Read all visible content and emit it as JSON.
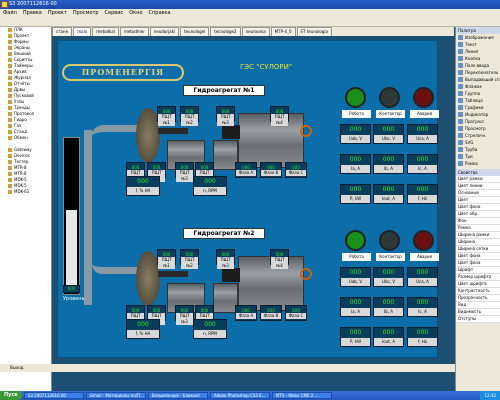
{
  "window": {
    "title": "S3 2007112616 00"
  },
  "menu": [
    "Файл",
    "Правка",
    "Проект",
    "Просмотр",
    "Сервис",
    "Окно",
    "Справка"
  ],
  "tabs": [
    "станн",
    "main",
    "metodkal",
    "metodmer",
    "neudorjakl",
    "teunologel",
    "tecnologe2",
    "neuroonia",
    "МТР-4_0",
    "ST teunologia"
  ],
  "left_tree": [
    "ПЛК",
    "Проект",
    "Формы",
    "Экраны",
    "Вешний",
    "Скрипты",
    "Таймеры",
    "Архив",
    "Журнал",
    "Отчёты",
    "Дрвы",
    "Пусковой",
    "Узлы",
    "Тренды",
    "Протокол",
    "Гидро",
    "Газ",
    "Станд",
    "Обмен"
  ],
  "left_tree2": [
    "Gateway",
    "Devices",
    "Тестер",
    "MTR-8",
    "MTR-8",
    "MDK-5",
    "MDK-5",
    "MDK-61"
  ],
  "right_panel": {
    "title": "Палитра",
    "items": [
      "Изображения",
      "Текст",
      "Линия",
      "Кнопка",
      "Поле ввода",
      "Переключатель",
      "Выпадающий список",
      "Флажок",
      "Группа",
      "Таблица",
      "Графики",
      "Индикатор",
      "Прогресс",
      "Просмотр",
      "Стрелочн.",
      "SVG",
      "Труба",
      "Три",
      "Рамка"
    ],
    "props_title": "Свойства",
    "props": [
      "Цвет рамки",
      "Цвет линии",
      "Основные",
      "Цвет",
      "Цвет фона",
      "Цвет обр.",
      "Фон",
      "Рамка",
      "Ширина рамки",
      "Ширина",
      "Ширина сетки",
      "Цвет фона",
      "Цвет фона",
      "Шрифт",
      "Размер шрифта",
      "Цвет шрифта",
      "Контрастность",
      "Прозрачность",
      "Вид",
      "Видимость",
      "Отступы"
    ]
  },
  "logo": "ПРОМЕНЕРГІЯ",
  "station": "ГЭС \"СУЛОРИ\"",
  "units": [
    {
      "title": "Гидроагрегат №1",
      "top_vals": [
        "000",
        "000",
        "000",
        "000"
      ],
      "top_labels": [
        "ПЩТ №1",
        "ПЩТ №2",
        "ПЩТ №3",
        "ПЩТ №4"
      ],
      "mid_vals": [
        "000",
        "000",
        "000",
        "000"
      ],
      "mid_labels": [
        "ПЩТ №1",
        "ПЩТ №2",
        "ПЩТ №3",
        "ПЩТ №4"
      ],
      "phase_vals": [
        "000",
        "000",
        "000"
      ],
      "phase_labels": [
        "Фаза А",
        "Фаза В",
        "Фаза С"
      ],
      "f_val": "000",
      "f_label": "f, % НА",
      "n_val": "000",
      "n_label": "n, RPM",
      "lamps": [
        "Работа",
        "Контактор",
        "Авария"
      ],
      "u_vals": [
        "000",
        "000",
        "000"
      ],
      "u_labels": [
        "Uab, V",
        "Ubc, V",
        "Uca, A"
      ],
      "i_vals": [
        "000",
        "000",
        "000"
      ],
      "i_labels": [
        "Ia, A",
        "Ib, A",
        "Ic, A"
      ],
      "p_vals": [
        "000",
        "000",
        "000"
      ],
      "p_labels": [
        "P, kW",
        "Iout, A",
        "f, Hz"
      ]
    },
    {
      "title": "Гидроагрегат №2",
      "top_vals": [
        "000",
        "000",
        "000",
        "000"
      ],
      "top_labels": [
        "ПЩТ №1",
        "ПЩТ №2",
        "ПЩТ №3",
        "ПЩТ №4"
      ],
      "mid_vals": [
        "000",
        "000",
        "000",
        "000"
      ],
      "mid_labels": [
        "ПЩТ №1",
        "ПЩТ №2",
        "ПЩТ №3",
        "ПЩТ №4"
      ],
      "phase_vals": [
        "000",
        "000",
        "000"
      ],
      "phase_labels": [
        "Фаза А",
        "Фаза В",
        "Фаза С"
      ],
      "f_val": "000",
      "f_label": "f, % НА",
      "n_val": "000",
      "n_label": "n, RPM",
      "lamps": [
        "Работа",
        "Контактор",
        "Авария"
      ],
      "u_vals": [
        "000",
        "000",
        "000"
      ],
      "u_labels": [
        "Uab, V",
        "Ubc, V",
        "Uca, A"
      ],
      "i_vals": [
        "000",
        "000",
        "000"
      ],
      "i_labels": [
        "Ia, A",
        "Ib, A",
        "Ic, A"
      ],
      "p_vals": [
        "000",
        "000",
        "000"
      ],
      "p_labels": [
        "P, kW",
        "Iout, A",
        "f, Hz"
      ]
    }
  ],
  "level": {
    "value": "000",
    "label": "Уровень",
    "fill_fraction": 0.55
  },
  "status": "Выход",
  "taskbar": {
    "start": "Пуск",
    "tasks": [
      "S3 2007112616 00",
      "Gmail - Материалы по/П...",
      "Безымянный - Блокнот",
      "Adobe Photoshop CS3 E...",
      "MTS - Webo CMS 2..."
    ],
    "clock": "12:42"
  },
  "colors": {
    "lamp_work": "#1b8e1b",
    "lamp_contact": "#2e3a38",
    "lamp_alarm": "#6a1010",
    "canvas": "#0b6ea8",
    "value_green": "#2eea2e"
  }
}
